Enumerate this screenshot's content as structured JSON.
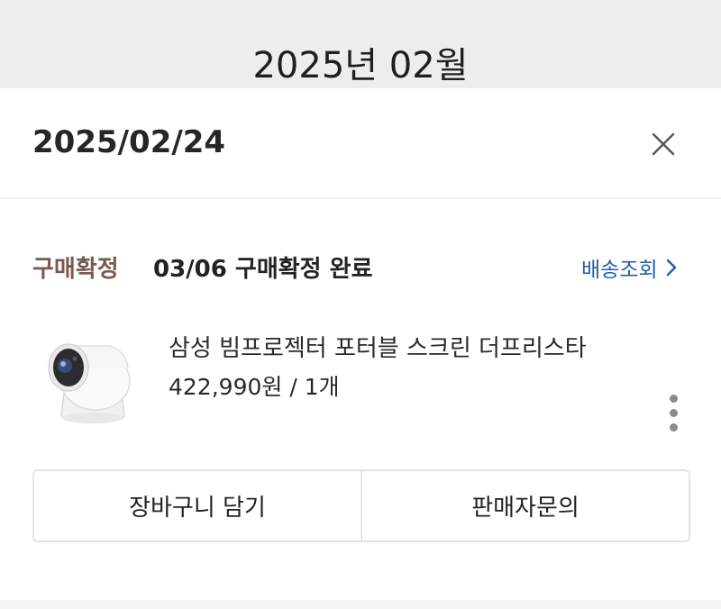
{
  "header": {
    "month_title": "2025년 02월"
  },
  "order": {
    "date": "2025/02/24",
    "status_label": "구매확정",
    "status_detail": "03/06 구매확정 완료",
    "tracking_link": "배송조회"
  },
  "product": {
    "name": "삼성 빔프로젝터 포터블 스크린 더프리스타",
    "price_qty": "422,990원 / 1개"
  },
  "actions": {
    "add_to_cart": "장바구니 담기",
    "contact_seller": "판매자문의"
  },
  "icons": {
    "close": "close-icon",
    "chevron": "chevron-right-icon",
    "more": "more-vertical-icon"
  },
  "colors": {
    "status": "#7a5a50",
    "link": "#1f5fa8",
    "header_bg": "#ededed"
  }
}
